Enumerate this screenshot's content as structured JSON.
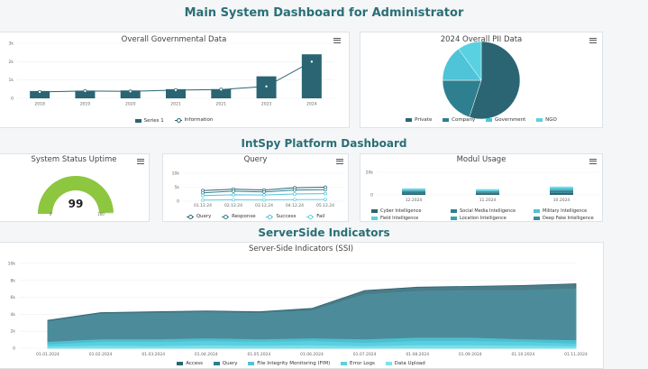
{
  "header": {
    "title": "Main System Dashboard for Administrator"
  },
  "sections": {
    "intspy": "IntSpy Platform Dashboard",
    "serverside": "ServerSide Indicators"
  },
  "colors": {
    "dark": "#2b6573",
    "mid": "#2e7f8f",
    "light": "#4fc3d7",
    "cyan": "#5ad1e0",
    "green": "#8dc63f"
  },
  "governmental": {
    "title": "Overall Governmental Data",
    "chart_data": {
      "type": "bar",
      "categories": [
        "2018",
        "2019",
        "2020",
        "2021",
        "2021",
        "2023",
        "2024"
      ],
      "series": [
        {
          "name": "Series 1",
          "type": "bar",
          "values": [
            400,
            420,
            430,
            500,
            500,
            1200,
            2400
          ]
        },
        {
          "name": "Information",
          "type": "line",
          "values": [
            350,
            400,
            380,
            450,
            480,
            650,
            2000
          ]
        }
      ],
      "ylim": [
        0,
        3000
      ],
      "yticks": [
        "3k",
        "2k",
        "1k",
        "0"
      ]
    }
  },
  "pii": {
    "title": "2024 Overall PII Data",
    "chart_data": {
      "type": "pie",
      "labels": [
        "Private",
        "Company",
        "Government",
        "NGO"
      ],
      "values": [
        55,
        20,
        15,
        10
      ]
    }
  },
  "uptime": {
    "title": "System Status Uptime",
    "value": "99",
    "min": "0",
    "max": "100",
    "level": 0.99
  },
  "query": {
    "title": "Query",
    "chart_data": {
      "type": "line",
      "x": [
        "01.12.24",
        "02.12.24",
        "03.12.24",
        "04.12.24",
        "05.12.24"
      ],
      "series": [
        {
          "name": "Query",
          "values": [
            3800,
            4300,
            4000,
            4800,
            5000
          ]
        },
        {
          "name": "Response",
          "values": [
            3000,
            3600,
            3300,
            4000,
            4100
          ]
        },
        {
          "name": "Success",
          "values": [
            2000,
            2300,
            2200,
            2600,
            2700
          ]
        },
        {
          "name": "Fail",
          "values": [
            400,
            500,
            450,
            550,
            600
          ]
        }
      ],
      "ylim": [
        0,
        10000
      ],
      "yticks": [
        "10k",
        "5k",
        "0"
      ]
    }
  },
  "modul": {
    "title": "Modul Usage",
    "chart_data": {
      "type": "bar",
      "stacked": true,
      "categories": [
        "12.2024",
        "11.2024",
        "10.2024"
      ],
      "series": [
        {
          "name": "Cyber Intelligence",
          "values": [
            3000,
            2500,
            3500
          ]
        },
        {
          "name": "Social Media Intelligence",
          "values": [
            2500,
            2000,
            3000
          ]
        },
        {
          "name": "Military Intelligence",
          "values": [
            2000,
            1800,
            2500
          ]
        },
        {
          "name": "Field Intelligence",
          "values": [
            1500,
            1500,
            2200
          ]
        },
        {
          "name": "Location Intelligence",
          "values": [
            1500,
            1400,
            2000
          ]
        },
        {
          "name": "Deep Fake Intelligence",
          "values": [
            1000,
            1000,
            1500
          ]
        }
      ],
      "ylim": [
        0,
        20000
      ],
      "yticks": [
        "20k",
        "0"
      ]
    }
  },
  "ssi": {
    "title": "Server-Side Indicators (SSI)",
    "chart_data": {
      "type": "area",
      "x": [
        "01.01.2024",
        "01.02.2024",
        "01.03.2024",
        "01.04.2024",
        "01.05.2024",
        "01.06.2024",
        "01.07.2024",
        "01.08.2024",
        "01.09.2024",
        "01.10.2024",
        "01.11.2024"
      ],
      "series": [
        {
          "name": "Access",
          "values": [
            3300,
            4200,
            4300,
            4400,
            4300,
            4700,
            6800,
            7200,
            7300,
            7400,
            7600
          ]
        },
        {
          "name": "Query",
          "values": [
            3100,
            4000,
            4100,
            4200,
            4100,
            4400,
            6300,
            6700,
            6800,
            6800,
            7000
          ]
        },
        {
          "name": "File Integrity Monitoring (FIM)",
          "values": [
            700,
            1000,
            1000,
            1100,
            1000,
            1100,
            1000,
            1200,
            1200,
            1000,
            900
          ]
        },
        {
          "name": "Error Logs",
          "values": [
            400,
            700,
            700,
            800,
            700,
            800,
            600,
            800,
            800,
            700,
            500
          ]
        },
        {
          "name": "Data Upload",
          "values": [
            150,
            250,
            200,
            300,
            250,
            300,
            200,
            300,
            300,
            250,
            200
          ]
        }
      ],
      "ylim": [
        0,
        10000
      ],
      "yticks": [
        "10k",
        "8k",
        "6k",
        "4k",
        "2k",
        "0"
      ]
    }
  }
}
